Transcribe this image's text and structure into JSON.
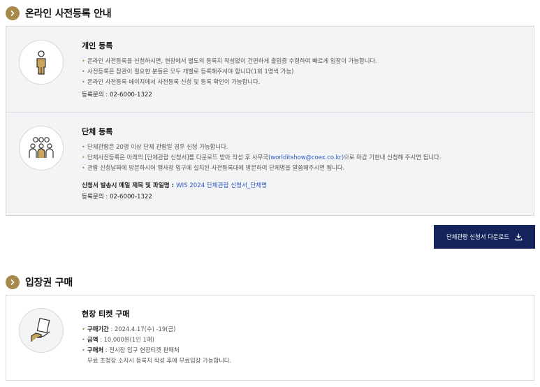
{
  "online_section": {
    "title": "온라인 사전등록 안내",
    "individual": {
      "heading": "개인 등록",
      "bullets": [
        "온라인 사전등록을 신청하시면, 현장에서 별도의 등록지 작성없이 간편하게 출입증 수령하여 빠르게 입장이 가능합니다.",
        "사전등록은 참관이 필요한 분들은 모두 개별로 등록해주셔야 합니다(1회 1명씩 가능)",
        "온라인 사전등록 페이지에서 사전등록 신청 및 등록 확인이 가능합니다."
      ],
      "contact": "등록문의 : 02-6000-1322"
    },
    "group": {
      "heading": "단체 등록",
      "bullets": [
        "단체관람은 20명 이상 단체 관람일 경우 신청 가능합니다.",
        "관람 신청날짜에 방문하시어 행사장 입구에 설치된 사전등록대에 방문하여 단체명을 말씀해주시면 됩니다."
      ],
      "bullet2_pre": "단체사전등록은 아래의 [단체관람 신청서]를 다운로드 받아 작성 후 사무국",
      "bullet2_email": "(worlditshow@coex.co.kr)",
      "bullet2_post": "으로 마감 기한내 신청해 주시면 됩니다.",
      "mail_label": "신청서 발송시 메일 제목 및 파일명 : ",
      "mail_value": "WIS 2024 단체관람 신청서_단체명",
      "contact": "등록문의 : 02-6000-1322"
    },
    "download_button": "단체관람 신청서 다운로드"
  },
  "ticket_section": {
    "title": "입장권 구매",
    "onsite": {
      "heading": "현장 티켓 구매",
      "items": [
        {
          "label": "구매기간",
          "value": " : 2024.4.17(수) -19(금)"
        },
        {
          "label": "금액",
          "value": " : 10,000원(1인 1매)"
        },
        {
          "label": "구매처",
          "value": " : 전시장 입구 현장티켓 판매처"
        }
      ],
      "note": "무료 초청장 소지시 등록지 작성 후에 무료입장 가능합니다."
    }
  },
  "colors": {
    "accent": "#a8894c",
    "navy": "#14245a",
    "link": "#2b59c3",
    "panel_bg": "#f3f4f6"
  },
  "icons": [
    "chevron-right-icon",
    "person-icon",
    "group-icon",
    "ticket-hand-icon",
    "download-icon"
  ]
}
